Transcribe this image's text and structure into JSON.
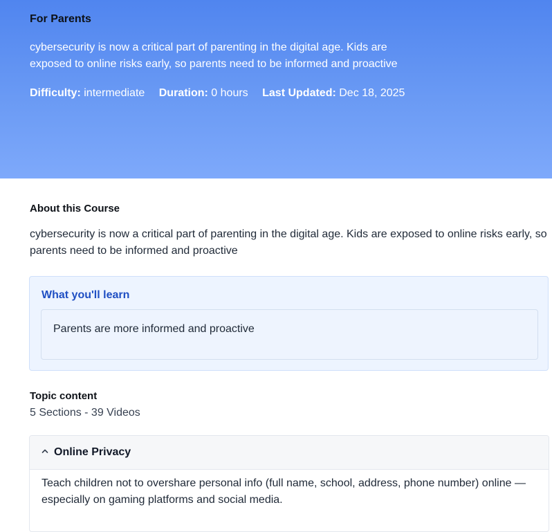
{
  "hero": {
    "title": "For Parents",
    "description": "cybersecurity is now a critical part of parenting in the digital age. Kids are exposed to online risks early, so parents need to be informed and proactive",
    "meta": {
      "difficulty_label": "Difficulty:",
      "difficulty_value": "intermediate",
      "duration_label": "Duration:",
      "duration_value": "0 hours",
      "updated_label": "Last Updated:",
      "updated_value": "Dec 18, 2025"
    }
  },
  "about": {
    "title": "About this Course",
    "description": "cybersecurity is now a critical part of parenting in the digital age. Kids are exposed to online risks early, so parents need to be informed and proactive"
  },
  "learn": {
    "title": "What you'll learn",
    "items": [
      "Parents are more informed and proactive"
    ]
  },
  "topics": {
    "title": "Topic content",
    "summary": "5 Sections - 39 Videos",
    "sections": [
      {
        "title": "Online Privacy",
        "expanded": true,
        "chevron_icon": "chevron-up-icon",
        "body": "Teach children not to overshare personal info (full name, school, address, phone number) online — especially on gaming platforms and social media."
      }
    ]
  },
  "colors": {
    "hero_gradient_top": "#5085ef",
    "hero_gradient_bottom": "#7ea9fb",
    "learn_title": "#1f4fc3",
    "learn_bg": "#edf4ff"
  }
}
